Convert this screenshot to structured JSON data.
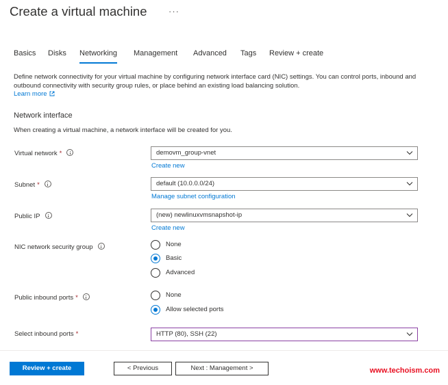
{
  "page": {
    "title": "Create a virtual machine",
    "more_label": "···"
  },
  "tabs": [
    {
      "label": "Basics"
    },
    {
      "label": "Disks"
    },
    {
      "label": "Networking",
      "active": true
    },
    {
      "label": "Management"
    },
    {
      "label": "Advanced"
    },
    {
      "label": "Tags"
    },
    {
      "label": "Review + create"
    }
  ],
  "intro": {
    "description": "Define network connectivity for your virtual machine by configuring network interface card (NIC) settings. You can control ports, inbound and outbound connectivity with security group rules, or place behind an existing load balancing solution.",
    "learn_more": "Learn more"
  },
  "network_interface": {
    "title": "Network interface",
    "description": "When creating a virtual machine, a network interface will be created for you."
  },
  "fields": {
    "virtual_network": {
      "label": "Virtual network",
      "required": "*",
      "value": "demovm_group-vnet",
      "link": "Create new"
    },
    "subnet": {
      "label": "Subnet",
      "required": "*",
      "value": "default (10.0.0.0/24)",
      "link": "Manage subnet configuration"
    },
    "public_ip": {
      "label": "Public IP",
      "value": "(new) newlinuxvmsnapshot-ip",
      "link": "Create new"
    },
    "nic_nsg": {
      "label": "NIC network security group",
      "options": [
        "None",
        "Basic",
        "Advanced"
      ],
      "selected": "Basic"
    },
    "public_inbound_ports": {
      "label": "Public inbound ports",
      "required": "*",
      "options": [
        "None",
        "Allow selected ports"
      ],
      "selected": "Allow selected ports"
    },
    "select_inbound_ports": {
      "label": "Select inbound ports",
      "required": "*",
      "value": "HTTP (80), SSH (22)"
    }
  },
  "footer": {
    "review_create": "Review + create",
    "previous": "< Previous",
    "next": "Next : Management >"
  },
  "watermark": "www.techoism.com",
  "colors": {
    "accent": "#0078d4",
    "required": "#a4262c",
    "focus_border": "#8a3fa3",
    "watermark": "#e81123"
  },
  "icons": {
    "info": "info-icon",
    "chevron": "chevron-down-icon",
    "external_link": "external-link-icon"
  }
}
